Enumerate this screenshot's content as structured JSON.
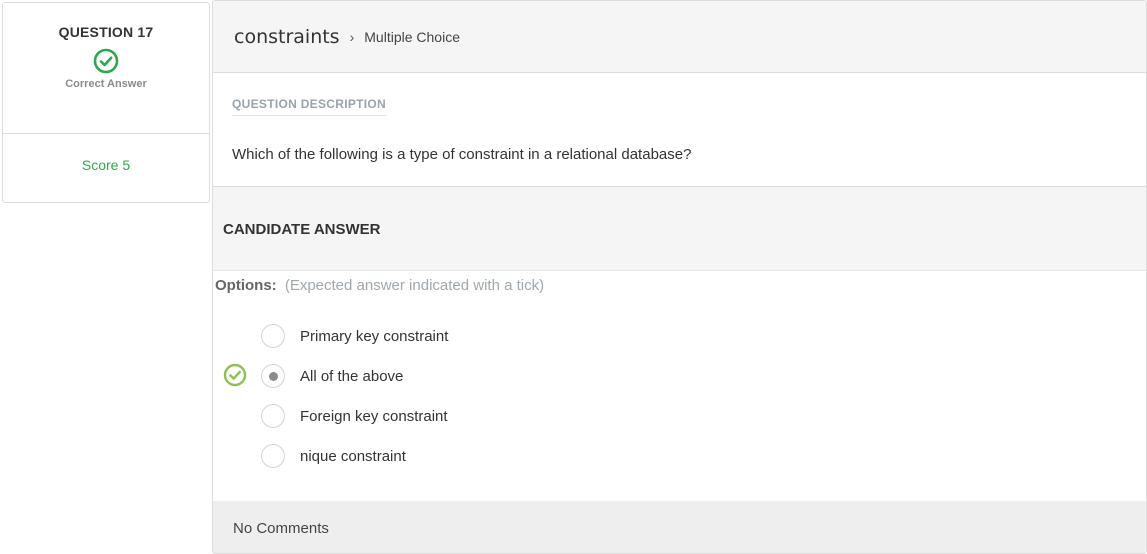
{
  "question": {
    "number_label": "QUESTION 17",
    "status": "Correct Answer",
    "score": "Score 5",
    "status_icon": "check-circle-icon",
    "status_color": "#2ea84a"
  },
  "header": {
    "topic": "constraints",
    "separator": "›",
    "type": "Multiple Choice"
  },
  "description": {
    "label": "QUESTION DESCRIPTION",
    "text": "Which of the following is a type of constraint in a relational database?"
  },
  "candidate": {
    "title": "CANDIDATE ANSWER",
    "options_label": "Options:",
    "options_note": "(Expected answer indicated with a tick)",
    "options": [
      {
        "label": "Primary key constraint",
        "selected": false,
        "expected": false
      },
      {
        "label": "All of the above",
        "selected": true,
        "expected": true
      },
      {
        "label": "Foreign key constraint",
        "selected": false,
        "expected": false
      },
      {
        "label": "nique constraint",
        "selected": false,
        "expected": false
      }
    ]
  },
  "comments": {
    "text": "No Comments"
  },
  "colors": {
    "correct_green": "#2ea84a",
    "tick_green": "#8cc152"
  }
}
